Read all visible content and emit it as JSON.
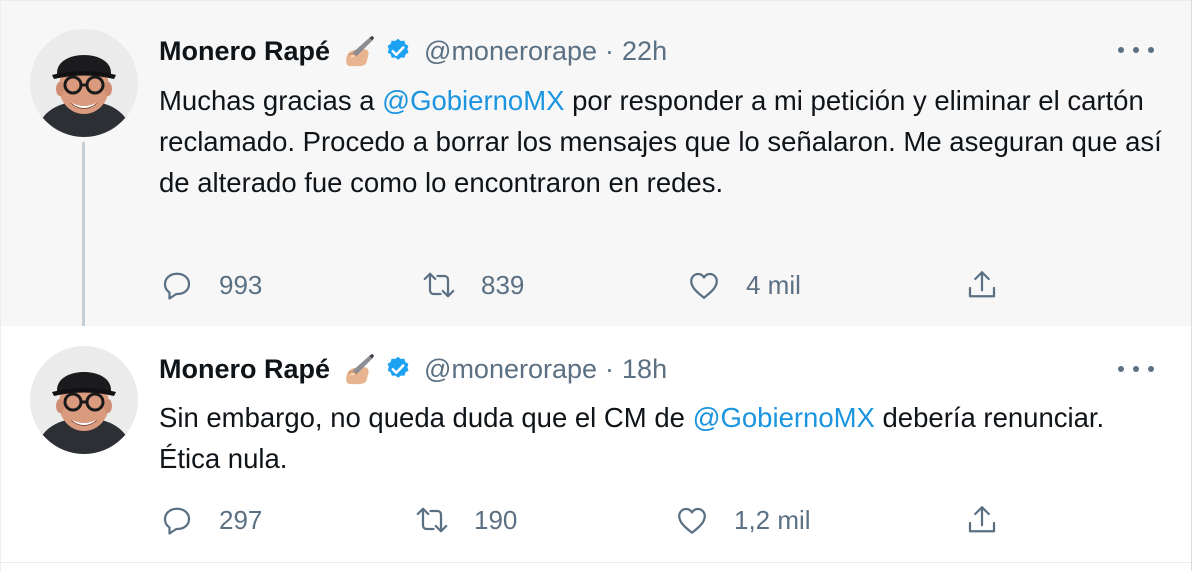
{
  "tweets": [
    {
      "author_name": "Monero Rapé",
      "author_emoji": "✍🏼",
      "handle": "@monerorape",
      "separator": "·",
      "time": "22h",
      "text_segments": {
        "s1": "Muchas gracias a ",
        "mention": "@GobiernoMX",
        "s2": " por responder a mi petición y eliminar el cartón reclamado. Procedo a borrar los mensajes que lo señalaron. Me aseguran que así de alterado fue como lo encontraron en redes."
      },
      "replies": "993",
      "retweets": "839",
      "likes": "4 mil"
    },
    {
      "author_name": "Monero Rapé",
      "author_emoji": "✍🏼",
      "handle": "@monerorape",
      "separator": "·",
      "time": "18h",
      "text_segments": {
        "s1": "Sin embargo, no queda duda que el CM de ",
        "mention": "@GobiernoMX",
        "s2": " debería renunciar. Ética nula."
      },
      "replies": "297",
      "retweets": "190",
      "likes": "1,2 mil"
    }
  ],
  "icons": {
    "reply": "reply-icon",
    "retweet": "retweet-icon",
    "like": "heart-icon",
    "share": "share-icon",
    "verified": "verified-badge-icon",
    "more": "more-options-icon"
  },
  "colors": {
    "accent": "#1b95e0",
    "muted": "#5b7083",
    "verified": "#1da1f2",
    "text": "#0f1419"
  }
}
